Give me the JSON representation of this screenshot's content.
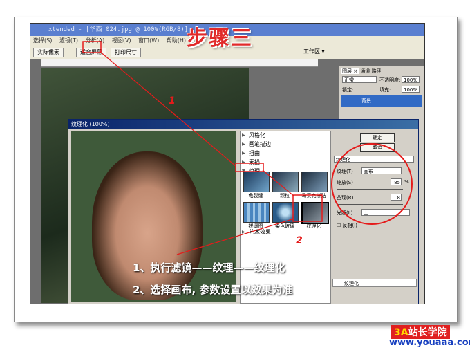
{
  "window": {
    "title": "xtended - [华西 024.jpg @ 100%(RGB/8)]"
  },
  "menu": [
    "选择(S)",
    "滤镜(T)",
    "分析(A)",
    "视图(V)",
    "窗口(W)",
    "帮助(H)"
  ],
  "options_bar": {
    "buttons": [
      "实际像素",
      "适合屏幕",
      "打印尺寸"
    ],
    "workspace": "工作区 ▾"
  },
  "layers_panel": {
    "tabs": [
      "图层 ×",
      "通道",
      "路径"
    ],
    "mode": "正常",
    "opacity_label": "不透明度:",
    "opacity": "100%",
    "lock_label": "锁定:",
    "fill_label": "填充:",
    "fill": "100%",
    "layer_name": "背景"
  },
  "dialog": {
    "title": "纹理化 (100%)",
    "filter_groups": [
      "风格化",
      "画笔描边",
      "扭曲",
      "素描",
      "纹理",
      "艺术效果"
    ],
    "thumbnails": [
      "龟裂缝",
      "颗粒",
      "马赛克拼贴",
      "拼缀图",
      "染色玻璃",
      "纹理化"
    ],
    "ok": "确定",
    "cancel": "取消",
    "filter_select": "纹理化",
    "texture_label": "纹理(T)",
    "texture_value": "画布",
    "scale_label": "缩放(S)",
    "scale_value": "85",
    "scale_unit": "%",
    "relief_label": "凸现(R)",
    "relief_value": "8",
    "light_label": "光照(L)",
    "light_value": "上",
    "invert_label": "反相(I)",
    "effect_layer": "纹理化"
  },
  "annotations": {
    "step_title": "步骤三",
    "line1": "1、执行滤镜——纹理——纹理化",
    "line2": "2、选择画布, 参数设置以效果为准",
    "marker1": "1",
    "marker2": "2"
  },
  "watermark": {
    "brand_prefix": "3A",
    "brand_rest": "站长学院",
    "url": "www.youaaa.com"
  }
}
